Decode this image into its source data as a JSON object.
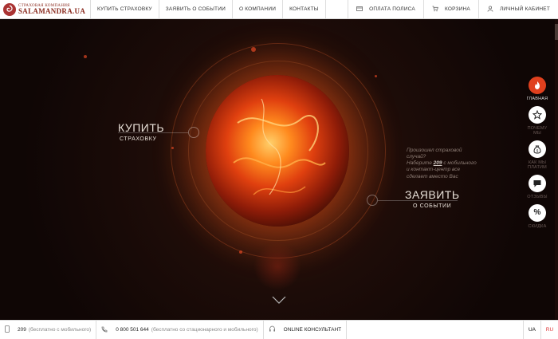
{
  "header": {
    "logo_subtitle": "СТРАХОВАЯ КОМПАНИЯ",
    "logo_title": "SALAMANDRA.UA",
    "nav": [
      "КУПИТЬ СТРАХОВКУ",
      "ЗАЯВИТЬ О СОБЫТИИ",
      "О КОМПАНИИ",
      "КОНТАКТЫ"
    ],
    "payment": "ОПЛАТА ПОЛИСА",
    "cart": "КОРЗИНА",
    "account": "ЛИЧНЫЙ КАБИНЕТ"
  },
  "hero": {
    "buy_big": "КУПИТЬ",
    "buy_small": "СТРАХОВКУ",
    "incident_line1": "Произошел страховой",
    "incident_line2": "случай?",
    "incident_line3_pre": "Наберите ",
    "incident_number": "209",
    "incident_line3_post": " с мобильного",
    "incident_line4": "и контакт-центр все",
    "incident_line5": "сделает вместо Вас",
    "claim_big": "ЗАЯВИТЬ",
    "claim_small": "О СОБЫТИИ"
  },
  "rail": [
    {
      "icon": "fire-icon",
      "label": "ГЛАВНАЯ"
    },
    {
      "icon": "star-icon",
      "label_1": "ПОЧЕМУ",
      "label_2": "МЫ"
    },
    {
      "icon": "money-bag-icon",
      "label_1": "КАК МЫ",
      "label_2": "ПЛАТИМ"
    },
    {
      "icon": "comment-icon",
      "label": "ОТЗЫВЫ"
    },
    {
      "icon": "percent-icon",
      "label": "СКИДКА"
    }
  ],
  "footer": {
    "phone_short": "209",
    "phone_short_note": "(бесплатно с мобильного)",
    "phone_long": "0 800 501 644",
    "phone_long_note": "(бесплатно со стационарного и мобильного)",
    "consultant": "ONLINE КОНСУЛЬТАНТ",
    "lang_ua": "UA",
    "lang_ru": "RU"
  },
  "colors": {
    "accent": "#e0401e",
    "logo": "#8a2a1e"
  }
}
